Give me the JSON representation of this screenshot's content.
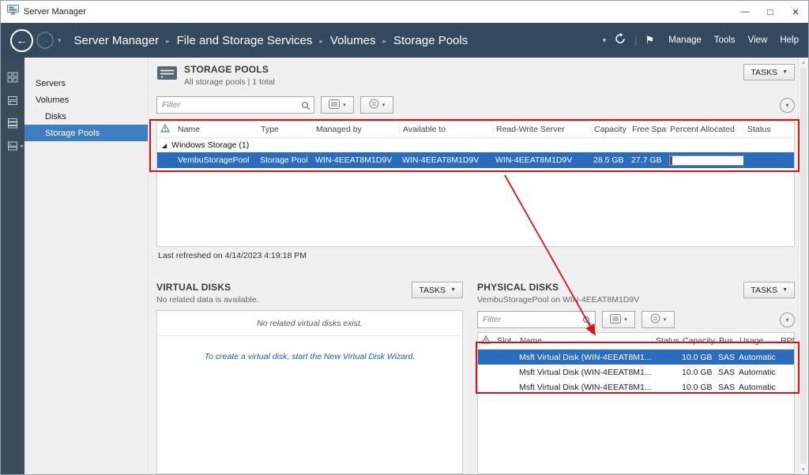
{
  "window": {
    "title": "Server Manager"
  },
  "icons": {
    "back": "←",
    "forward": "→",
    "caret_down": "▾",
    "caret_down_small": "▼",
    "flag": "⚑",
    "divider": "|",
    "breadcrumb_sep": "▸",
    "flyout": "▸",
    "minimize": "—",
    "maximize": "□",
    "close": "×",
    "group_expanded": "◢",
    "scroll_up": "▴",
    "scroll_down": "▾"
  },
  "navbar": {
    "breadcrumb": [
      "Server Manager",
      "File and Storage Services",
      "Volumes",
      "Storage Pools"
    ],
    "menus": [
      "Manage",
      "Tools",
      "View",
      "Help"
    ]
  },
  "sidebar": {
    "items": [
      {
        "label": "Servers"
      },
      {
        "label": "Volumes"
      },
      {
        "label": "Disks"
      },
      {
        "label": "Storage Pools"
      }
    ]
  },
  "storage_pools": {
    "title": "STORAGE POOLS",
    "subtitle": "All storage pools | 1 total",
    "tasks_label": "TASKS",
    "filter_placeholder": "Filter",
    "columns": {
      "name": "Name",
      "type": "Type",
      "managed_by": "Managed by",
      "available_to": "Available to",
      "rw_server": "Read-Write Server",
      "capacity": "Capacity",
      "free_space": "Free Space",
      "percent_allocated": "Percent Allocated",
      "status": "Status"
    },
    "group_label": "Windows Storage (1)",
    "row": {
      "name": "VembuStoragePool",
      "type": "Storage Pool",
      "managed_by": "WIN-4EEAT8M1D9V",
      "available_to": "WIN-4EEAT8M1D9V",
      "rw_server": "WIN-4EEAT8M1D9V",
      "capacity": "28.5 GB",
      "free_space": "27.7 GB",
      "percent_allocated_pct": 3
    },
    "last_refreshed": "Last refreshed on 4/14/2023 4:19:18 PM"
  },
  "virtual_disks": {
    "title": "VIRTUAL DISKS",
    "subtitle": "No related data is available.",
    "tasks_label": "TASKS",
    "empty_message": "No related virtual disks exist.",
    "wizard_message": "To create a virtual disk, start the New Virtual Disk Wizard."
  },
  "physical_disks": {
    "title": "PHYSICAL DISKS",
    "subtitle": "VembuStoragePool on WIN-4EEAT8M1D9V",
    "tasks_label": "TASKS",
    "filter_placeholder": "Filter",
    "columns": {
      "slot": "Slot",
      "name": "Name",
      "status": "Status",
      "capacity": "Capacity",
      "bus": "Bus",
      "usage": "Usage",
      "rpm": "RPM"
    },
    "rows": [
      {
        "name": "Msft Virtual Disk (WIN-4EEAT8M1...",
        "capacity": "10.0 GB",
        "bus": "SAS",
        "usage": "Automatic"
      },
      {
        "name": "Msft Virtual Disk (WIN-4EEAT8M1...",
        "capacity": "10.0 GB",
        "bus": "SAS",
        "usage": "Automatic"
      },
      {
        "name": "Msft Virtual Disk (WIN-4EEAT8M1...",
        "capacity": "10.0 GB",
        "bus": "SAS",
        "usage": "Automatic"
      }
    ]
  },
  "colors": {
    "navbar": "#35495e",
    "row_selection": "#2a6cbe",
    "sidebar_selection": "#3e7dc0",
    "annotation": "#dd1111"
  }
}
